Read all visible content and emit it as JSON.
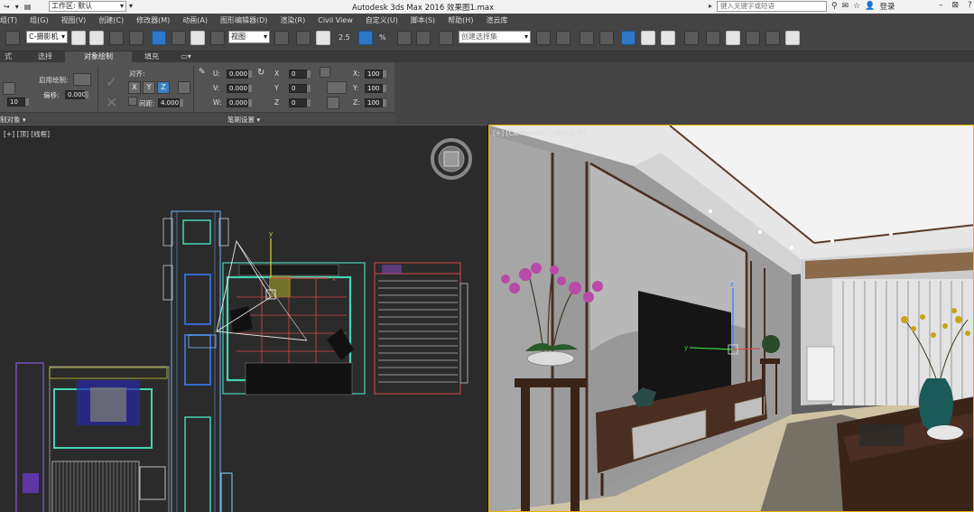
{
  "titlebar": {
    "workspace_label": "工作区: 默认",
    "title": "Autodesk 3ds Max 2016      效果图1.max",
    "search_placeholder": "键入关键字或短语",
    "login": "登录"
  },
  "menu": [
    {
      "label": "组(T)"
    },
    {
      "label": "组(G)"
    },
    {
      "label": "视图(V)"
    },
    {
      "label": "创建(C)"
    },
    {
      "label": "修改器(M)"
    },
    {
      "label": "动画(A)"
    },
    {
      "label": "图形编辑器(D)"
    },
    {
      "label": "渲染(R)"
    },
    {
      "label": "Civil View"
    },
    {
      "label": "自定义(U)"
    },
    {
      "label": "脚本(S)"
    },
    {
      "label": "帮助(H)"
    },
    {
      "label": "渲云库"
    }
  ],
  "toolbar": {
    "selection_filter": "C-摄影机",
    "reference_coord": "视图",
    "named_selection": "创建选择集",
    "snap_label": "2.5",
    "percent_snap": "%"
  },
  "ribbon_tabs": [
    {
      "label": "式",
      "active": false
    },
    {
      "label": "选择",
      "active": false
    },
    {
      "label": "对象绘制",
      "active": true
    },
    {
      "label": "填充",
      "active": false
    }
  ],
  "ribbon": {
    "enable_paint_label": "启用绘制:",
    "offset_label": "偏移:",
    "offset_value": "0.000",
    "left_value": "10",
    "align_label": "对齐:",
    "x_btn": "X",
    "y_btn": "Y",
    "z_btn": "Z",
    "spacing_label": "间距:",
    "spacing_value": "4.000",
    "u_label": "U:",
    "u_value": "0.000",
    "v_label": "V:",
    "v_value": "0.000",
    "w_label": "W:",
    "w_value": "0.000",
    "rx_label": "X",
    "rx_value": "0",
    "ry_label": "Y",
    "ry_value": "0",
    "rz_label": "Z",
    "rz_value": "0",
    "sx_label": "X:",
    "sx_value": "100",
    "sy_label": "Y:",
    "sy_value": "100",
    "sz_label": "Z:",
    "sz_value": "100",
    "footer_left": "制对象 ▾",
    "footer_center": "笔刷设置 ▾"
  },
  "viewports": {
    "left_label": "[+] [顶] [线框]",
    "right_label": "[+] [Camera001] [明暗处理]"
  },
  "colors": {
    "active_viewport_border": "#e8b400",
    "selection_blue": "#2f78c8"
  }
}
